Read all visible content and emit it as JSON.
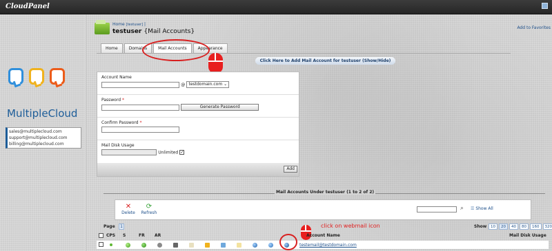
{
  "app": {
    "brand": "CloudPanel"
  },
  "header": {
    "breadcrumb_home": "Home",
    "breadcrumb_user": "[testuser]",
    "breadcrumb_sep": "|",
    "title_user": "testuser",
    "title_section": "{Mail Accounts}",
    "add_favorites": "Add to Favorites"
  },
  "sidebar": {
    "logo_text": "MultipleCloud",
    "emails": [
      "sales@multiplecloud.com",
      "support@multiplecloud.com",
      "billing@multiplecloud.com"
    ]
  },
  "tabs": [
    {
      "label": "Home",
      "active": false
    },
    {
      "label": "Domains",
      "active": false
    },
    {
      "label": "Mail Accounts",
      "active": true
    },
    {
      "label": "Appearance",
      "active": false
    }
  ],
  "show_hide_bar": "Click Here to Add Mail Account for testuser (Show/Hide)",
  "form": {
    "account_name_label": "Account Name",
    "account_name_value": "",
    "at_sign": "@",
    "domain_selected": "testdomain.com",
    "password_label": "Password",
    "generate_password_label": "Generate Password",
    "confirm_password_label": "Confirm Password",
    "required_mark": "*",
    "disk_usage_label": "Mail Disk Usage",
    "unlimited_label": "Unlimited",
    "unlimited_checked": "✓",
    "add_button": "Add"
  },
  "list": {
    "section_title": "Mail Accounts Under testuser (1 to 2 of 2)",
    "toolbar": {
      "delete": "Delete",
      "refresh": "Refresh",
      "show_all": "Show All"
    },
    "page_label": "Page",
    "page_number": "1",
    "show_label": "Show",
    "show_options": [
      "10",
      "20",
      "40",
      "80",
      "160",
      "320"
    ],
    "selected_show": "20",
    "columns": {
      "cps": "CPS",
      "s": "S",
      "fr": "FR",
      "ar": "AR",
      "account_name": "Account Name",
      "disk_usage": "Mail Disk Usage"
    },
    "rows": [
      {
        "account": "testemail@testdomain.com"
      }
    ]
  },
  "annotation": {
    "webmail_note": "click on webmail icon"
  }
}
